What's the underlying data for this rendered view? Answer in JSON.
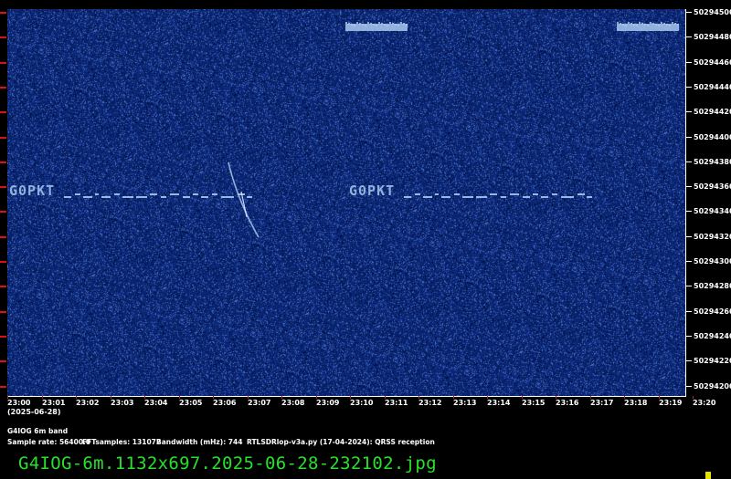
{
  "y_axis_labels": [
    "50294500",
    "50294480",
    "50294460",
    "50294440",
    "50294420",
    "50294400",
    "50294380",
    "50294360",
    "50294340",
    "50294320",
    "50294300",
    "50294280",
    "50294260",
    "50294240",
    "50294220",
    "50294200"
  ],
  "x_axis_labels": [
    "23:00",
    "23:01",
    "23:02",
    "23:03",
    "23:04",
    "23:05",
    "23:06",
    "23:07",
    "23:08",
    "23:09",
    "23:10",
    "23:11",
    "23:12",
    "23:13",
    "23:14",
    "23:15",
    "23:16",
    "23:17",
    "23:18",
    "23:19",
    "23:20"
  ],
  "date_label": "(2025-06-28)",
  "station_label": "G4IOG 6m band",
  "sample_rate": "Sample rate: 56400.0",
  "fft_samples": "FFTsamples: 131072",
  "bandwidth": "Bandwidth (mHz): 744",
  "software": "RTLSDRlop-v3a.py (17-04-2024): QRSS reception",
  "filename": "G4IOG-6m.1132x697.2025-06-28-232102.jpg",
  "colors": {
    "background": "#0a2a78",
    "signal": "#a9c8ee",
    "tick_red": "#e01010",
    "filename_green": "#27e12b",
    "corner_yellow": "#e7e300"
  },
  "signal_text": "G0PKT"
}
